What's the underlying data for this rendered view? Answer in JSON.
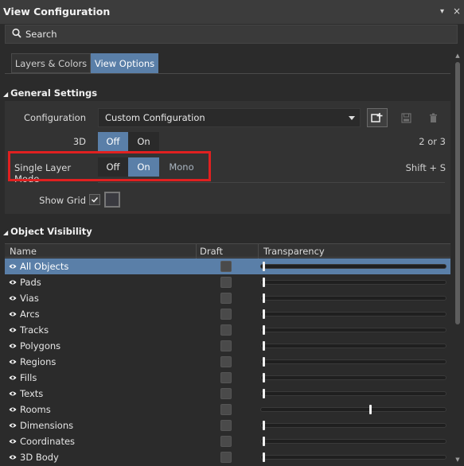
{
  "window": {
    "title": "View Configuration",
    "pin_glyph": "▾",
    "close_glyph": "×"
  },
  "search": {
    "label": "Search",
    "icon": "search-icon"
  },
  "tabs": [
    {
      "label": "Layers & Colors",
      "active": false
    },
    {
      "label": "View Options",
      "active": true
    }
  ],
  "general_settings": {
    "header": "General Settings",
    "configuration": {
      "label": "Configuration",
      "value": "Custom Configuration"
    },
    "toolbar_icons": [
      "add-config-icon",
      "save-icon",
      "delete-icon"
    ],
    "three_d": {
      "label": "3D",
      "options": [
        "Off",
        "On"
      ],
      "selected": "Off",
      "shortcut": "2 or 3"
    },
    "single_layer_mode": {
      "label": "Single Layer Mode",
      "options": [
        "Off",
        "On",
        "Mono"
      ],
      "selected": "On",
      "shortcut": "Shift + S"
    },
    "show_grid": {
      "label": "Show Grid",
      "checked": true
    }
  },
  "object_visibility": {
    "header": "Object Visibility",
    "columns": [
      "Name",
      "Draft",
      "Transparency"
    ],
    "rows": [
      {
        "name": "All Objects",
        "selected": true,
        "transparency": 0.0
      },
      {
        "name": "Pads",
        "transparency": 0.0
      },
      {
        "name": "Vias",
        "transparency": 0.0
      },
      {
        "name": "Arcs",
        "transparency": 0.0
      },
      {
        "name": "Tracks",
        "transparency": 0.0
      },
      {
        "name": "Polygons",
        "transparency": 0.0
      },
      {
        "name": "Regions",
        "transparency": 0.0
      },
      {
        "name": "Fills",
        "transparency": 0.0
      },
      {
        "name": "Texts",
        "transparency": 0.0
      },
      {
        "name": "Rooms",
        "transparency": 0.6
      },
      {
        "name": "Dimensions",
        "transparency": 0.0
      },
      {
        "name": "Coordinates",
        "transparency": 0.0
      },
      {
        "name": "3D Body",
        "transparency": 0.0
      }
    ]
  },
  "colors": {
    "accent": "#5a7fa8",
    "highlight_box": "#e02020",
    "background": "#2b2b2b"
  }
}
